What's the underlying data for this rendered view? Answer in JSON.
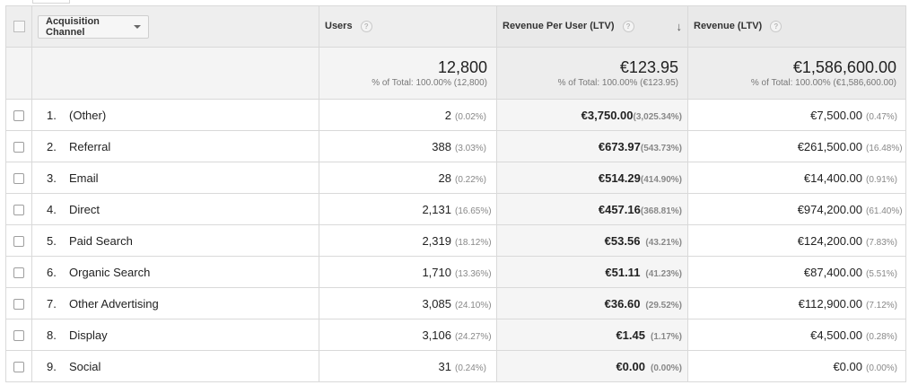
{
  "table": {
    "headers": {
      "channel": "Acquisition Channel",
      "users": "Users",
      "rpu": "Revenue Per User (LTV)",
      "revenue": "Revenue (LTV)",
      "help": "?",
      "sort_arrow": "↓"
    },
    "totals": {
      "users": "12,800",
      "users_sub": "% of Total: 100.00% (12,800)",
      "rpu": "€123.95",
      "rpu_sub": "% of Total: 100.00% (€123.95)",
      "revenue": "€1,586,600.00",
      "revenue_sub": "% of Total: 100.00% (€1,586,600.00)"
    },
    "rows": [
      {
        "index": "1.",
        "channel": "(Other)",
        "users": "2",
        "users_pct": "(0.02%)",
        "rpu": "€3,750.00",
        "rpu_pct": "(3,025.34%)",
        "revenue": "€7,500.00",
        "revenue_pct": "(0.47%)"
      },
      {
        "index": "2.",
        "channel": "Referral",
        "users": "388",
        "users_pct": "(3.03%)",
        "rpu": "€673.97",
        "rpu_pct": "(543.73%)",
        "revenue": "€261,500.00",
        "revenue_pct": "(16.48%)"
      },
      {
        "index": "3.",
        "channel": "Email",
        "users": "28",
        "users_pct": "(0.22%)",
        "rpu": "€514.29",
        "rpu_pct": "(414.90%)",
        "revenue": "€14,400.00",
        "revenue_pct": "(0.91%)"
      },
      {
        "index": "4.",
        "channel": "Direct",
        "users": "2,131",
        "users_pct": "(16.65%)",
        "rpu": "€457.16",
        "rpu_pct": "(368.81%)",
        "revenue": "€974,200.00",
        "revenue_pct": "(61.40%)"
      },
      {
        "index": "5.",
        "channel": "Paid Search",
        "users": "2,319",
        "users_pct": "(18.12%)",
        "rpu": "€53.56",
        "rpu_pct": "(43.21%)",
        "revenue": "€124,200.00",
        "revenue_pct": "(7.83%)"
      },
      {
        "index": "6.",
        "channel": "Organic Search",
        "users": "1,710",
        "users_pct": "(13.36%)",
        "rpu": "€51.11",
        "rpu_pct": "(41.23%)",
        "revenue": "€87,400.00",
        "revenue_pct": "(5.51%)"
      },
      {
        "index": "7.",
        "channel": "Other Advertising",
        "users": "3,085",
        "users_pct": "(24.10%)",
        "rpu": "€36.60",
        "rpu_pct": "(29.52%)",
        "revenue": "€112,900.00",
        "revenue_pct": "(7.12%)"
      },
      {
        "index": "8.",
        "channel": "Display",
        "users": "3,106",
        "users_pct": "(24.27%)",
        "rpu": "€1.45",
        "rpu_pct": "(1.17%)",
        "revenue": "€4,500.00",
        "revenue_pct": "(0.28%)"
      },
      {
        "index": "9.",
        "channel": "Social",
        "users": "31",
        "users_pct": "(0.24%)",
        "rpu": "€0.00",
        "rpu_pct": "(0.00%)",
        "revenue": "€0.00",
        "revenue_pct": "(0.00%)"
      }
    ]
  },
  "colors": {
    "header_bg": "#eeeeee",
    "totals_bg": "#f4f4f4",
    "sorted_column_bg": "#f5f5f5",
    "border": "#d9d9d9",
    "muted_text": "#888888"
  }
}
